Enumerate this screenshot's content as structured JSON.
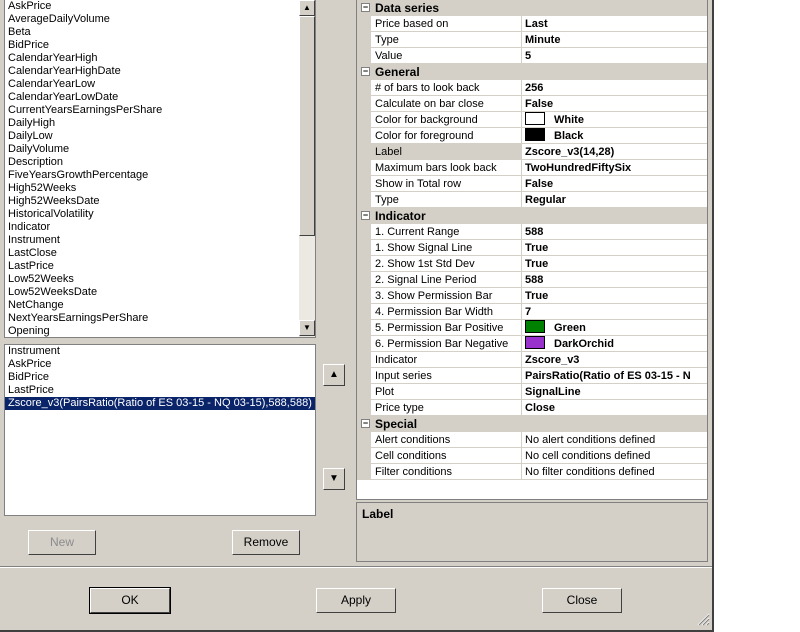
{
  "available_fields": [
    "AskPrice",
    "AverageDailyVolume",
    "Beta",
    "BidPrice",
    "CalendarYearHigh",
    "CalendarYearHighDate",
    "CalendarYearLow",
    "CalendarYearLowDate",
    "CurrentYearsEarningsPerShare",
    "DailyHigh",
    "DailyLow",
    "DailyVolume",
    "Description",
    "FiveYearsGrowthPercentage",
    "High52Weeks",
    "High52WeeksDate",
    "HistoricalVolatility",
    "Indicator",
    "Instrument",
    "LastClose",
    "LastPrice",
    "Low52Weeks",
    "Low52WeeksDate",
    "NetChange",
    "NextYearsEarningsPerShare",
    "Opening"
  ],
  "selected_columns": [
    "Instrument",
    "AskPrice",
    "BidPrice",
    "LastPrice",
    "Zscore_v3(PairsRatio(Ratio of ES 03-15 - NQ 03-15),588,588) on"
  ],
  "selected_index": 4,
  "icons": {
    "up": "arrow-up-icon",
    "down": "arrow-down-icon",
    "scroll_up": "scroll-up-icon",
    "scroll_down": "scroll-down-icon",
    "expand": "collapse-minus-icon",
    "grip": "resize-grip-icon"
  },
  "buttons": {
    "new": "New",
    "remove": "Remove",
    "ok": "OK",
    "apply": "Apply",
    "close": "Close"
  },
  "categories": [
    {
      "name": "Data series",
      "props": [
        {
          "name": "Price based on",
          "value": "Last"
        },
        {
          "name": "Type",
          "value": "Minute"
        },
        {
          "name": "Value",
          "value": "5"
        }
      ]
    },
    {
      "name": "General",
      "props": [
        {
          "name": "# of bars to look back",
          "value": "256"
        },
        {
          "name": "Calculate on bar close",
          "value": "False"
        },
        {
          "name": "Color for background",
          "value": "White",
          "color": "#ffffff"
        },
        {
          "name": "Color for foreground",
          "value": "Black",
          "color": "#000000"
        },
        {
          "name": "Label",
          "value": "Zscore_v3(14,28)",
          "highlight": true
        },
        {
          "name": "Maximum bars look back",
          "value": "TwoHundredFiftySix"
        },
        {
          "name": "Show in Total row",
          "value": "False"
        },
        {
          "name": "Type",
          "value": "Regular"
        }
      ]
    },
    {
      "name": "Indicator",
      "props": [
        {
          "name": "1. Current Range",
          "value": "588"
        },
        {
          "name": "1. Show Signal Line",
          "value": "True"
        },
        {
          "name": "2. Show 1st Std Dev",
          "value": "True"
        },
        {
          "name": "2. Signal Line Period",
          "value": "588"
        },
        {
          "name": "3. Show Permission Bar",
          "value": "True"
        },
        {
          "name": "4. Permission Bar Width",
          "value": "7"
        },
        {
          "name": "5. Permission Bar Positive",
          "value": "Green",
          "color": "#008000"
        },
        {
          "name": "6. Permission Bar Negative",
          "value": "DarkOrchid",
          "color": "#9932cc"
        },
        {
          "name": "Indicator",
          "value": "Zscore_v3"
        },
        {
          "name": "Input series",
          "value": "PairsRatio(Ratio of ES 03-15 - N"
        },
        {
          "name": "Plot",
          "value": "SignalLine"
        },
        {
          "name": "Price type",
          "value": "Close"
        }
      ]
    },
    {
      "name": "Special",
      "props": [
        {
          "name": "Alert conditions",
          "value": "No alert conditions defined",
          "plain": true
        },
        {
          "name": "Cell conditions",
          "value": "No cell conditions defined",
          "plain": true
        },
        {
          "name": "Filter conditions",
          "value": "No filter conditions defined",
          "plain": true
        }
      ]
    }
  ],
  "description_title": "Label"
}
